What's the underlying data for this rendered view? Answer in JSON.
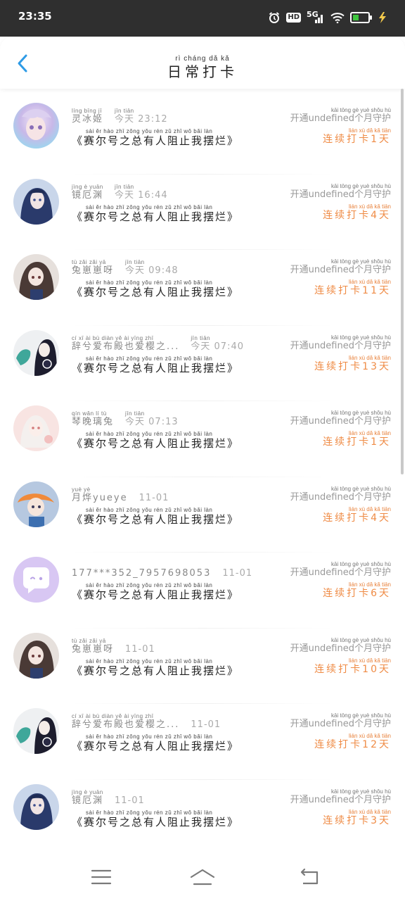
{
  "status_bar": {
    "time": "23:35",
    "icons": [
      "alarm-icon",
      "hd-badge",
      "signal-5g-icon",
      "wifi-icon",
      "battery-icon",
      "charging-icon"
    ],
    "hd_label": "HD",
    "network_label": "5G"
  },
  "header": {
    "title_pinyin": "rì cháng dǎ kǎ",
    "title": "日常打卡",
    "back_icon": "chevron-left-icon"
  },
  "entries": [
    {
      "name_pinyin": "líng bīng jī",
      "name": "灵冰姬",
      "time_pinyin": "jīn tiān",
      "time": "今天 23:12",
      "message_pinyin": "sài ěr hào zhī zǒng yǒu rén zǔ zhǐ wǒ bǎi làn",
      "message": "《赛尔号之总有人阻止我摆烂》",
      "member_pinyin": "kāi tōng              gè yuè shǒu hù",
      "member": "开通undefined个月守护",
      "streak_pinyin": "lián xù dǎ kǎ      tiān",
      "streak": "连续打卡1天"
    },
    {
      "name_pinyin": "jìng è yuān",
      "name": "镜厄渊",
      "time_pinyin": "jīn tiān",
      "time": "今天 16:44",
      "message_pinyin": "sài ěr hào zhī zǒng yǒu rén zǔ zhǐ wǒ bǎi làn",
      "message": "《赛尔号之总有人阻止我摆烂》",
      "member_pinyin": "kāi tōng              gè yuè shǒu hù",
      "member": "开通undefined个月守护",
      "streak_pinyin": "lián xù dǎ kǎ      tiān",
      "streak": "连续打卡4天"
    },
    {
      "name_pinyin": "tù zǎi zǎi yā",
      "name": "兔崽崽呀",
      "time_pinyin": "jīn tiān",
      "time": "今天 09:48",
      "message_pinyin": "sài ěr hào zhī zǒng yǒu rén zǔ zhǐ wǒ bǎi làn",
      "message": "《赛尔号之总有人阻止我摆烂》",
      "member_pinyin": "kāi tōng              gè yuè shǒu hù",
      "member": "开通undefined个月守护",
      "streak_pinyin": "lián xù dǎ kǎ        tiān",
      "streak": "连续打卡11天"
    },
    {
      "name_pinyin": "cí xī ài bù diàn yě ài yīng zhī",
      "name": "辞兮爱布殿也爱樱之...",
      "time_pinyin": "jīn tiān",
      "time": "今天 07:40",
      "message_pinyin": "sài ěr hào zhī zǒng yǒu rén zǔ zhǐ wǒ bǎi làn",
      "message": "《赛尔号之总有人阻止我摆烂》",
      "member_pinyin": "kāi tōng              gè yuè shǒu hù",
      "member": "开通undefined个月守护",
      "streak_pinyin": "lián xù dǎ kǎ        tiān",
      "streak": "连续打卡13天"
    },
    {
      "name_pinyin": "qín wǎn lí tù",
      "name": "琴晚璃兔",
      "time_pinyin": "jīn tiān",
      "time": "今天 07:13",
      "message_pinyin": "sài ěr hào zhī zǒng yǒu rén zǔ zhǐ wǒ bǎi làn",
      "message": "《赛尔号之总有人阻止我摆烂》",
      "member_pinyin": "kāi tōng              gè yuè shǒu hù",
      "member": "开通undefined个月守护",
      "streak_pinyin": "lián xù dǎ kǎ      tiān",
      "streak": "连续打卡1天"
    },
    {
      "name_pinyin": "yuè yè",
      "name": "月烨yueye",
      "time_pinyin": "",
      "time": "11-01",
      "message_pinyin": "sài ěr hào zhī zǒng yǒu rén zǔ zhǐ wǒ bǎi làn",
      "message": "《赛尔号之总有人阻止我摆烂》",
      "member_pinyin": "kāi tōng              gè yuè shǒu hù",
      "member": "开通undefined个月守护",
      "streak_pinyin": "lián xù dǎ kǎ      tiān",
      "streak": "连续打卡4天"
    },
    {
      "name_pinyin": "",
      "name": "177***352_7957698053",
      "time_pinyin": "",
      "time": "11-01",
      "message_pinyin": "sài ěr hào zhī zǒng yǒu rén zǔ zhǐ wǒ bǎi làn",
      "message": "《赛尔号之总有人阻止我摆烂》",
      "member_pinyin": "kāi tōng              gè yuè shǒu hù",
      "member": "开通undefined个月守护",
      "streak_pinyin": "lián xù dǎ kǎ      tiān",
      "streak": "连续打卡6天"
    },
    {
      "name_pinyin": "tù zǎi zǎi yā",
      "name": "兔崽崽呀",
      "time_pinyin": "",
      "time": "11-01",
      "message_pinyin": "sài ěr hào zhī zǒng yǒu rén zǔ zhǐ wǒ bǎi làn",
      "message": "《赛尔号之总有人阻止我摆烂》",
      "member_pinyin": "kāi tōng              gè yuè shǒu hù",
      "member": "开通undefined个月守护",
      "streak_pinyin": "lián xù dǎ kǎ        tiān",
      "streak": "连续打卡10天"
    },
    {
      "name_pinyin": "cí xī ài bù diàn yě ài yīng zhī",
      "name": "辞兮爱布殿也爱樱之...",
      "time_pinyin": "",
      "time": "11-01",
      "message_pinyin": "sài ěr hào zhī zǒng yǒu rén zǔ zhǐ wǒ bǎi làn",
      "message": "《赛尔号之总有人阻止我摆烂》",
      "member_pinyin": "kāi tōng              gè yuè shǒu hù",
      "member": "开通undefined个月守护",
      "streak_pinyin": "lián xù dǎ kǎ        tiān",
      "streak": "连续打卡12天"
    },
    {
      "name_pinyin": "jìng è yuān",
      "name": "镜厄渊",
      "time_pinyin": "",
      "time": "11-01",
      "message_pinyin": "sài ěr hào zhī zǒng yǒu rén zǔ zhǐ wǒ bǎi làn",
      "message": "《赛尔号之总有人阻止我摆烂》",
      "member_pinyin": "kāi tōng              gè yuè shǒu hù",
      "member": "开通undefined个月守护",
      "streak_pinyin": "lián xù dǎ kǎ      tiān",
      "streak": "连续打卡3天"
    }
  ],
  "nav_bar": {
    "icons": [
      "menu-icon",
      "home-icon",
      "back-icon"
    ]
  },
  "colors": {
    "status_bar_bg": "#2f2f2f",
    "accent_blue": "#2e9be6",
    "streak_orange": "#ef8b45",
    "avatar_chat_purple": "#d8c7f3"
  }
}
